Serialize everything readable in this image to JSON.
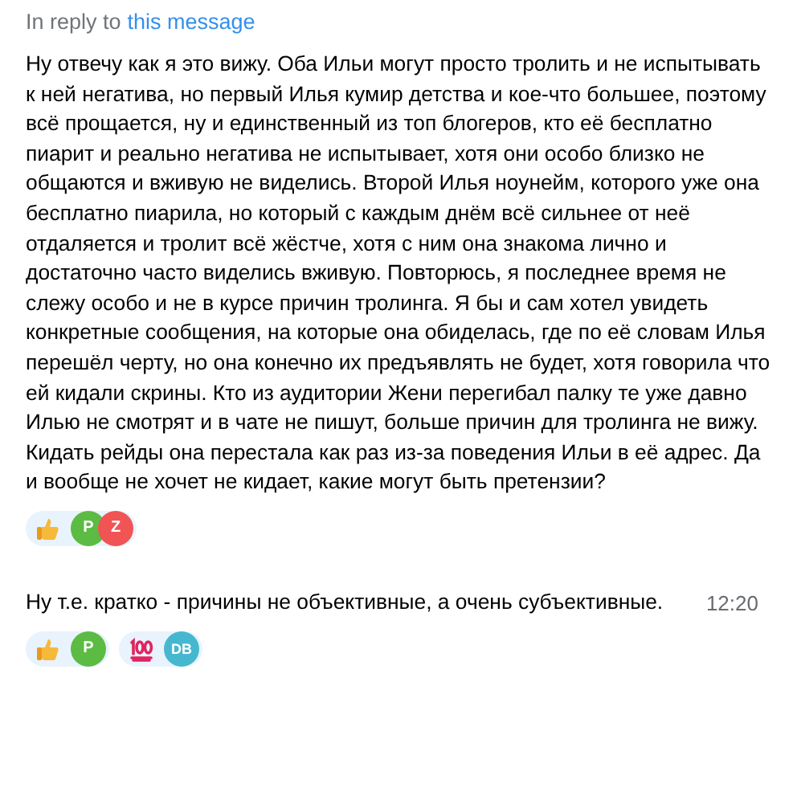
{
  "reply_header": {
    "prefix": "In reply to",
    "link": "this message"
  },
  "messages": [
    {
      "text": "Ну отвечу как я это вижу. Оба Ильи могут просто тролить и не испытывать к ней негатива, но первый Илья кумир детства и кое-что большее, поэтому всё прощается, ну и единственный из топ блогеров, кто её бесплатно пиарит и реально негатива не испытывает, хотя они особо близко не общаются и вживую не виделись. Второй Илья ноунейм, которого уже она бесплатно пиарила, но который с каждым днём всё сильнее от неё отдаляется и тролит всё жёстче, хотя с ним она знакома лично и достаточно часто виделись вживую. Повторюсь, я последнее время не слежу особо и не в курсе причин тролинга. Я бы и сам хотел увидеть конкретные сообщения, на которые она обиделась, где по её словам Илья перешёл черту, но она конечно их предъявлять не будет, хотя говорила что ей кидали скрины. Кто из аудитории Жени перегибал палку те уже давно Илью не смотрят и в чате не пишут, больше причин для тролинга не вижу. Кидать рейды она перестала как раз из-за поведения Ильи в её адрес. Да и вообще не хочет не кидает, какие могут быть претензии?",
      "reactions": [
        {
          "kind": "thumbs_up",
          "users": [
            {
              "initials": "P",
              "color": "#5cbb43"
            },
            {
              "initials": "Z",
              "color": "#f05454"
            }
          ]
        }
      ]
    },
    {
      "text": "Ну т.е. кратко - причины не объективные, а очень субъективные.",
      "time": "12:20",
      "reactions": [
        {
          "kind": "thumbs_up",
          "users": [
            {
              "initials": "P",
              "color": "#5cbb43"
            }
          ]
        },
        {
          "kind": "hundred",
          "users": [
            {
              "initials": "DB",
              "color": "#45b8d0"
            }
          ]
        }
      ]
    }
  ]
}
